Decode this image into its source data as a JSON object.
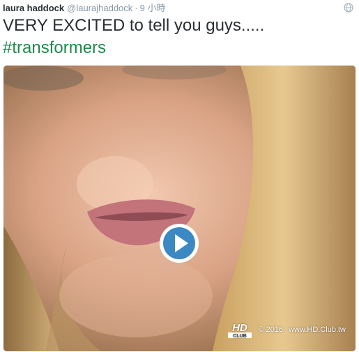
{
  "tweet": {
    "author_name": "laura haddock",
    "author_handle": "@laurajhaddock",
    "separator": "·",
    "timestamp": "9 小時",
    "text_line": "VERY EXCITED to tell you guys.....",
    "hashtag": "#transformers",
    "more_icon": "globe-icon"
  },
  "media": {
    "type": "video",
    "play_icon": "play-icon",
    "watermark": {
      "logo_text": "HD",
      "logo_subtext": "CLUB",
      "copyright": "© 2016",
      "site": "www.HD.Club.tw"
    }
  },
  "colors": {
    "name": "#292f33",
    "muted": "#8899a6",
    "hashtag": "#1b8a4a",
    "play_ring": "#ffffff",
    "play_fill": "#3b88c3"
  }
}
